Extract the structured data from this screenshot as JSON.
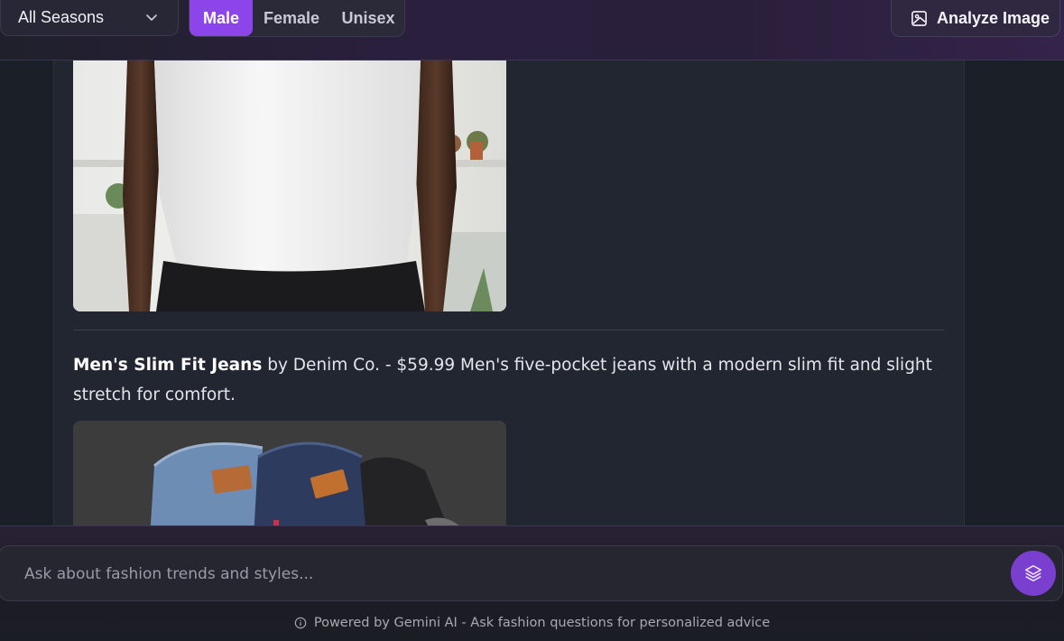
{
  "filters": {
    "season_value": "All Seasons",
    "gender_options": [
      {
        "label": "Male",
        "active": true
      },
      {
        "label": "Female",
        "active": false
      },
      {
        "label": "Unisex",
        "active": false
      }
    ]
  },
  "toolbar": {
    "analyze_label": "Analyze Image"
  },
  "product": {
    "name": "Men's Slim Fit Jeans",
    "brand_text": "by Denim Co. - $59.99",
    "description": "Men's five-pocket jeans with a modern slim fit and slight stretch for comfort."
  },
  "chat": {
    "placeholder": "Ask about fashion trends and styles...",
    "footer": "Powered by Gemini AI - Ask fashion questions for personalized advice"
  },
  "colors": {
    "accent": "#8b45e8",
    "background": "#1b1f27",
    "panel": "#222630"
  },
  "icons": [
    "chevron-down-icon",
    "image-icon",
    "layers-icon",
    "info-icon"
  ]
}
